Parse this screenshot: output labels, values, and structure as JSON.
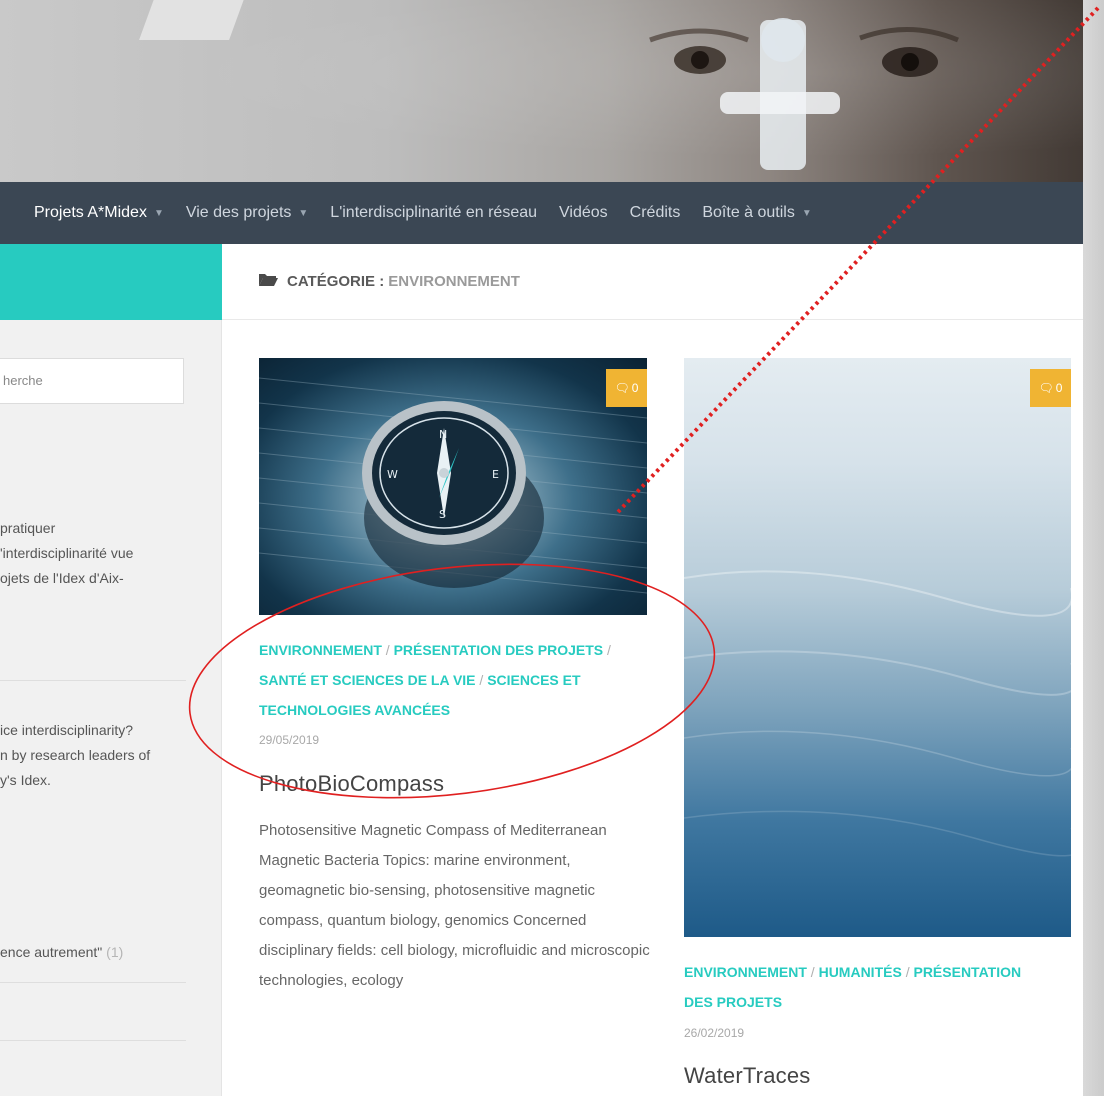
{
  "nav": {
    "items": [
      {
        "label": "Projets A*Midex",
        "caret": true
      },
      {
        "label": "Vie des projets",
        "caret": true
      },
      {
        "label": "L'interdisciplinarité en réseau",
        "caret": false
      },
      {
        "label": "Vidéos",
        "caret": false
      },
      {
        "label": "Crédits",
        "caret": false
      },
      {
        "label": "Boîte à outils",
        "caret": true
      }
    ]
  },
  "sidebar": {
    "search_placeholder": "herche",
    "fr_lines": [
      "pratiquer",
      "'interdisciplinarité vue",
      "ojets de l'Idex d'Aix-"
    ],
    "en_lines": [
      "ice interdisciplinarity?",
      "n by research leaders of",
      "y's Idex."
    ],
    "cat_item": {
      "label": "ence autrement\"",
      "count": "(1)"
    }
  },
  "category": {
    "prefix": "CATÉGORIE :",
    "name": "ENVIRONNEMENT"
  },
  "posts": [
    {
      "comments": "0",
      "categories": [
        [
          "ENVIRONNEMENT",
          "PRÉSENTATION DES PROJETS",
          ""
        ],
        [
          "SANTÉ ET SCIENCES DE LA VIE",
          "SCIENCES ET"
        ],
        [
          "TECHNOLOGIES AVANCÉES"
        ]
      ],
      "date": "29/05/2019",
      "title": "PhotoBioCompass",
      "excerpt": "Photosensitive Magnetic Compass of Mediterranean Magnetic Bacteria Topics: marine environment, geomagnetic bio-sensing, photosensitive magnetic compass, quantum biology, genomics Concerned disciplinary fields: cell biology, microfluidic and microscopic technologies, ecology"
    },
    {
      "comments": "0",
      "categories": [
        [
          "ENVIRONNEMENT",
          "HUMANITÉS",
          "PRÉSENTATION"
        ],
        [
          "DES PROJETS"
        ]
      ],
      "date": "26/02/2019",
      "title": "WaterTraces"
    }
  ],
  "colors": {
    "accent": "#27cbc0",
    "nav_bg": "#3b4754",
    "badge": "#f0b433",
    "annotation": "#e02020"
  }
}
